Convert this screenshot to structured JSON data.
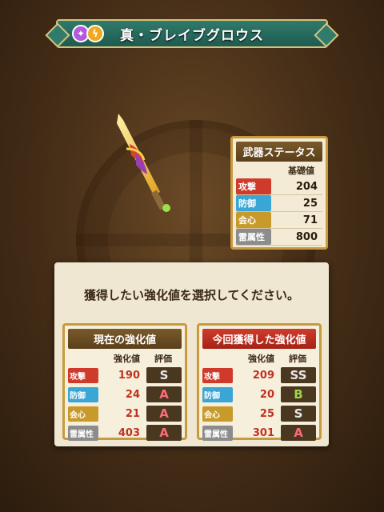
{
  "title": "真・ブレイブグロウス",
  "element_icons": [
    "purple-orb-icon",
    "lightning-icon"
  ],
  "weapon_status": {
    "title": "武器ステータス",
    "column": "基礎値",
    "rows": [
      {
        "label": "攻撃",
        "value": "204",
        "color": "#cf3b2b"
      },
      {
        "label": "防御",
        "value": "25",
        "color": "#3aa6d6"
      },
      {
        "label": "会心",
        "value": "71",
        "color": "#c79a2a"
      },
      {
        "label": "雷属性",
        "value": "800",
        "color": "#8c8c8c"
      }
    ]
  },
  "prompt": "獲得したい強化値を選択してください。",
  "choices": {
    "current": {
      "title": "現在の強化値",
      "col_value": "強化値",
      "col_grade": "評価",
      "rows": [
        {
          "label": "攻撃",
          "value": "190",
          "grade": "S"
        },
        {
          "label": "防御",
          "value": "24",
          "grade": "A"
        },
        {
          "label": "会心",
          "value": "21",
          "grade": "A"
        },
        {
          "label": "雷属性",
          "value": "403",
          "grade": "A"
        }
      ]
    },
    "new": {
      "title": "今回獲得した強化値",
      "col_value": "強化値",
      "col_grade": "評価",
      "rows": [
        {
          "label": "攻撃",
          "value": "209",
          "grade": "SS"
        },
        {
          "label": "防御",
          "value": "20",
          "grade": "B"
        },
        {
          "label": "会心",
          "value": "25",
          "grade": "S"
        },
        {
          "label": "雷属性",
          "value": "301",
          "grade": "A"
        }
      ]
    }
  }
}
